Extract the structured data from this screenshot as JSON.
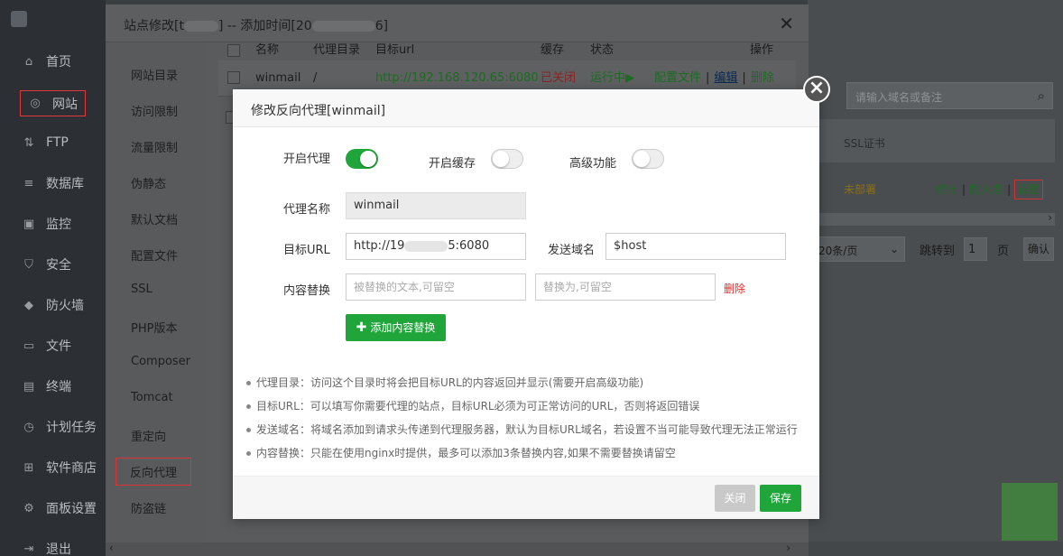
{
  "sidebar": {
    "items": [
      {
        "label": "首页",
        "icon": "home-icon"
      },
      {
        "label": "网站",
        "icon": "globe-icon"
      },
      {
        "label": "FTP",
        "icon": "ftp-icon"
      },
      {
        "label": "数据库",
        "icon": "database-icon"
      },
      {
        "label": "监控",
        "icon": "monitor-icon"
      },
      {
        "label": "安全",
        "icon": "shield-icon"
      },
      {
        "label": "防火墙",
        "icon": "firewall-icon"
      },
      {
        "label": "文件",
        "icon": "folder-icon"
      },
      {
        "label": "终端",
        "icon": "terminal-icon"
      },
      {
        "label": "计划任务",
        "icon": "clock-icon"
      },
      {
        "label": "软件商店",
        "icon": "grid-icon"
      },
      {
        "label": "面板设置",
        "icon": "gear-icon"
      },
      {
        "label": "退出",
        "icon": "logout-icon"
      }
    ]
  },
  "background": {
    "search_placeholder": "请输入域名或备注",
    "ssl_header": "SSL证书",
    "status_undeployed": "未部署",
    "row_links": [
      "统计",
      "防火墙",
      "设置"
    ],
    "per_page": "20条/页",
    "jump_to": "跳转到",
    "page_value": "1",
    "page_unit": "页",
    "confirm": "确认"
  },
  "site_window": {
    "title": "站点修改[t",
    "title_mid": "] -- 添加时间[20",
    "title_end": "6]",
    "nav": [
      "网站目录",
      "访问限制",
      "流量限制",
      "伪静态",
      "默认文档",
      "配置文件",
      "SSL",
      "PHP版本",
      "Composer",
      "Tomcat",
      "重定向",
      "反向代理",
      "防盗链"
    ],
    "active_nav": "反向代理",
    "table": {
      "headers": [
        "名称",
        "代理目录",
        "目标url",
        "缓存",
        "状态",
        "操作"
      ],
      "row": {
        "name": "winmail",
        "dir": "/",
        "url": "http://192.168.120.65:6080",
        "cache": "已关闭",
        "status": "运行中▶",
        "actions": [
          "配置文件",
          "编辑",
          "删除"
        ]
      }
    }
  },
  "modal": {
    "title": "修改反向代理[winmail]",
    "toggles": {
      "enable_proxy": {
        "label": "开启代理",
        "on": true
      },
      "enable_cache": {
        "label": "开启缓存",
        "on": false
      },
      "advanced": {
        "label": "高级功能",
        "on": false
      }
    },
    "proxy_name": {
      "label": "代理名称",
      "value": "winmail"
    },
    "target_url": {
      "label": "目标URL",
      "value_prefix": "http://19",
      "value_suffix": "5:6080"
    },
    "send_domain": {
      "label": "发送域名",
      "value": "$host"
    },
    "content_replace": {
      "label": "内容替换",
      "from_placeholder": "被替换的文本,可留空",
      "to_placeholder": "替换为,可留空",
      "delete": "删除"
    },
    "add_button": "添加内容替换",
    "notes": [
      "代理目录：访问这个目录时将会把目标URL的内容返回并显示(需要开启高级功能)",
      "目标URL：可以填写你需要代理的站点，目标URL必须为可正常访问的URL，否则将返回错误",
      "发送域名：将域名添加到请求头传递到代理服务器，默认为目标URL域名，若设置不当可能导致代理无法正常运行",
      "内容替换：只能在使用nginx时提供，最多可以添加3条替换内容,如果不需要替换请留空"
    ],
    "buttons": {
      "close": "关闭",
      "save": "保存"
    }
  }
}
